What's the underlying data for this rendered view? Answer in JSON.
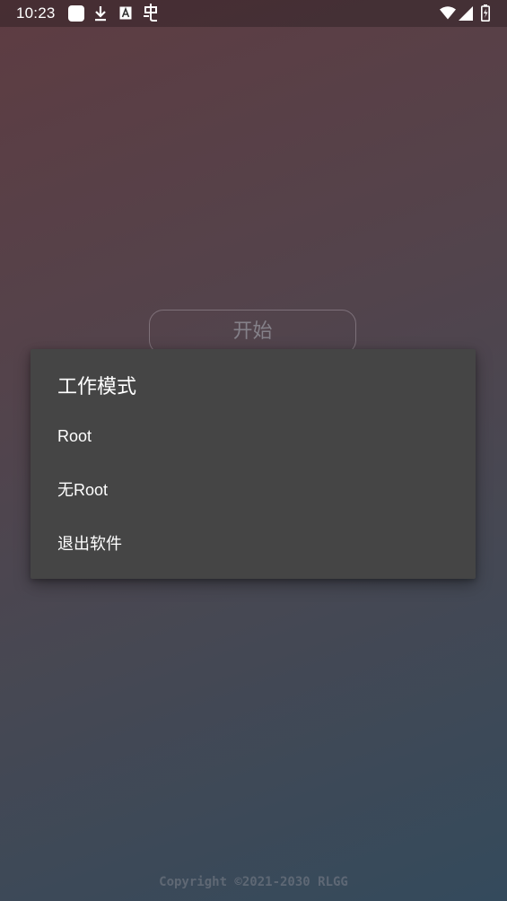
{
  "status_bar": {
    "time": "10:23",
    "notification_icons": [
      "app-square-icon",
      "download-icon",
      "a-box-icon",
      "ghost-icon"
    ],
    "system_icons": [
      "wifi-icon",
      "signal-icon",
      "battery-charging-icon"
    ]
  },
  "main": {
    "start_button_label": "开始"
  },
  "dialog": {
    "title": "工作模式",
    "options": [
      {
        "label": "Root"
      },
      {
        "label": "无Root"
      },
      {
        "label": "退出软件"
      }
    ]
  },
  "footer": {
    "copyright": "Copyright ©2021-2030 RLGG"
  },
  "colors": {
    "background_top": "#5e3c42",
    "background_bottom": "#344a5c",
    "dialog_background": "#454545",
    "text": "#ffffff"
  }
}
